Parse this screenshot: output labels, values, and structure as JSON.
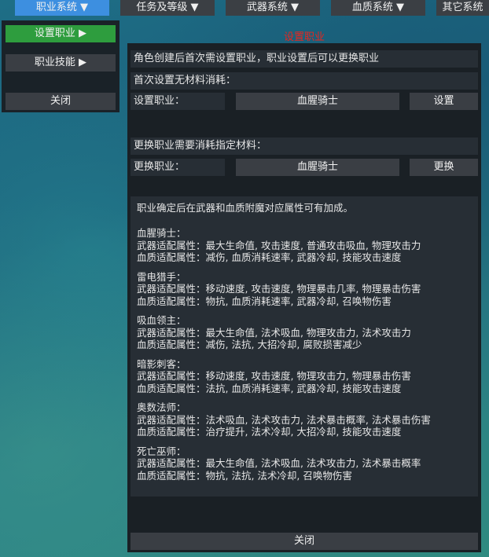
{
  "topbar": {
    "career": "职业系统 ▼",
    "quest": "任务及等级 ▼",
    "weapon": "武器系统 ▼",
    "blood": "血质系统 ▼",
    "other": "其它系统"
  },
  "left_menu": {
    "set_career": "设置职业 ▶",
    "career_skill": "职业技能 ▶",
    "close": "关闭"
  },
  "panel": {
    "title": "设置职业",
    "desc": "角色创建后首次需设置职业，职业设置后可以更换职业",
    "first_set_note": "首次设置无材料消耗：",
    "set_label": "设置职业：",
    "set_value": "血腥骑士",
    "set_button": "设置",
    "change_note": "更换职业需要消耗指定材料：",
    "change_label": "更换职业：",
    "change_value": "血腥骑士",
    "change_button": "更换",
    "info_intro": "职业确定后在武器和血质附魔对应属性可有加成。",
    "classes": [
      {
        "name": "血腥骑士：",
        "weapon": "武器适配属性：最大生命值, 攻击速度, 普通攻击吸血, 物理攻击力",
        "blood": "血质适配属性：减伤, 血质消耗速率, 武器冷却, 技能攻击速度"
      },
      {
        "name": "雷电猎手：",
        "weapon": "武器适配属性：移动速度, 攻击速度, 物理暴击几率, 物理暴击伤害",
        "blood": "血质适配属性：物抗, 血质消耗速率, 武器冷却, 召唤物伤害"
      },
      {
        "name": "吸血领主：",
        "weapon": "武器适配属性：最大生命值, 法术吸血, 物理攻击力, 法术攻击力",
        "blood": "血质适配属性：减伤, 法抗, 大招冷却, 腐败损害减少"
      },
      {
        "name": "暗影刺客：",
        "weapon": "武器适配属性：移动速度, 攻击速度, 物理攻击力, 物理暴击伤害",
        "blood": "血质适配属性：法抗, 血质消耗速率, 武器冷却, 技能攻击速度"
      },
      {
        "name": "奥数法师：",
        "weapon": "武器适配属性：法术吸血, 法术攻击力, 法术暴击概率, 法术暴击伤害",
        "blood": "血质适配属性：治疗提升, 法术冷却, 大招冷却, 技能攻击速度"
      },
      {
        "name": "死亡巫师：",
        "weapon": "武器适配属性：最大生命值, 法术吸血, 法术攻击力, 法术暴击概率",
        "blood": "血质适配属性：物抗, 法抗, 法术冷却, 召唤物伤害"
      }
    ],
    "close": "关闭"
  }
}
